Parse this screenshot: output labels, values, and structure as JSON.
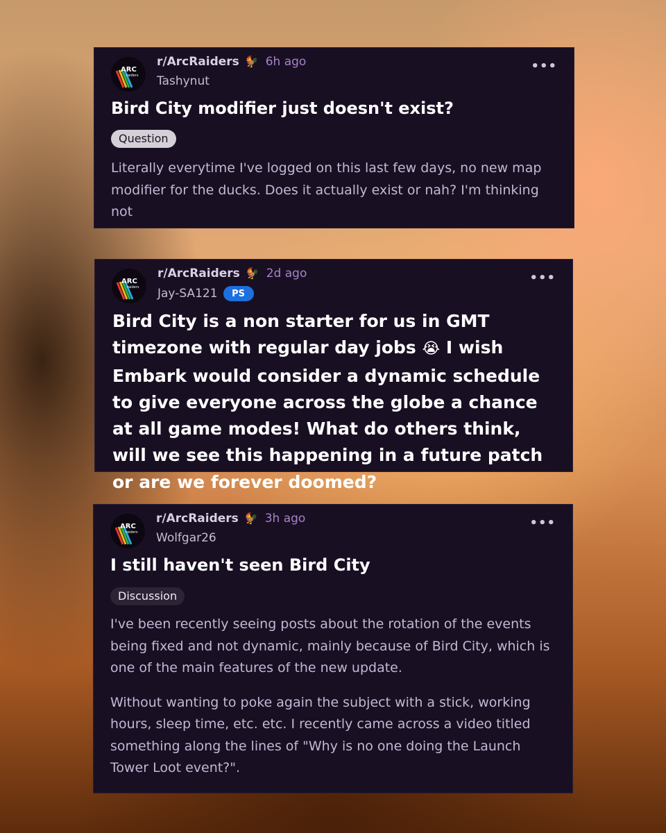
{
  "posts": [
    {
      "subreddit": "r/ArcRaiders",
      "bird": "🐓",
      "time_ago": "6h ago",
      "username": "Tashynut",
      "title": "Bird City modifier just doesn't exist?",
      "flair": "Question",
      "body": [
        "Literally everytime I've logged on this last few days, no new map modifier for the ducks. Does it actually exist or nah? I'm thinking not"
      ],
      "more": "•••"
    },
    {
      "subreddit": "r/ArcRaiders",
      "bird": "🐓",
      "time_ago": "2d ago",
      "username": "Jay-SA121",
      "platform_badge": "PS",
      "body_part1": "Bird City is a non starter for us in GMT timezone with regular day jobs ",
      "emoji": "😭",
      "body_part2": " I wish Embark would consider a dynamic schedule to give everyone across the globe a chance at all game modes! What do others think, will we see this happening in a future patch or are we forever doomed?",
      "more": "•••"
    },
    {
      "subreddit": "r/ArcRaiders",
      "bird": "🐓",
      "time_ago": "3h ago",
      "username": "Wolfgar26",
      "title": "I still haven't seen Bird City",
      "flair": "Discussion",
      "body": [
        "I've been recently seeing posts about the rotation of the events being fixed and not dynamic, mainly because of Bird City, which is one of the main features of the new update.",
        "Without wanting to poke again the subject with a stick, working hours, sleep time, etc. etc. I recently came across a video titled something along the lines of \"Why is no one doing the Launch Tower Loot event?\"."
      ],
      "more": "•••"
    }
  ],
  "avatar_logo": {
    "line1": "ARC",
    "line2": "raiders"
  },
  "colors": {
    "card_bg": "#190f22",
    "time_ago": "#a583c9",
    "body_text": "#c3b8d4",
    "playstation_badge": "#1d6fe0"
  },
  "icons": [
    "arc-raiders-logo-icon",
    "rooster-icon",
    "playstation-icon",
    "more-options-icon"
  ]
}
